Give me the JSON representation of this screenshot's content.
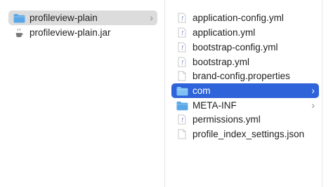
{
  "columns": {
    "left": {
      "items": [
        {
          "label": "profileview-plain",
          "icon": "folder-icon",
          "chevron": "›",
          "selected": "gray"
        },
        {
          "label": "profileview-plain.jar",
          "icon": "jar-icon"
        }
      ]
    },
    "right": {
      "items": [
        {
          "label": "application-config.yml",
          "icon": "yml-file-icon"
        },
        {
          "label": "application.yml",
          "icon": "yml-file-icon"
        },
        {
          "label": "bootstrap-config.yml",
          "icon": "yml-file-icon"
        },
        {
          "label": "bootstrap.yml",
          "icon": "yml-file-icon"
        },
        {
          "label": "brand-config.properties",
          "icon": "document-icon"
        },
        {
          "label": "com",
          "icon": "folder-icon",
          "chevron": "›",
          "selected": "blue"
        },
        {
          "label": "META-INF",
          "icon": "folder-icon",
          "chevron": "›"
        },
        {
          "label": "permissions.yml",
          "icon": "yml-file-icon"
        },
        {
          "label": "profile_index_settings.json",
          "icon": "document-icon"
        }
      ]
    }
  },
  "colors": {
    "selection_blue": "#2e63d9",
    "selection_gray": "#dcdcdc",
    "folder_blue": "#5aa7e8"
  }
}
